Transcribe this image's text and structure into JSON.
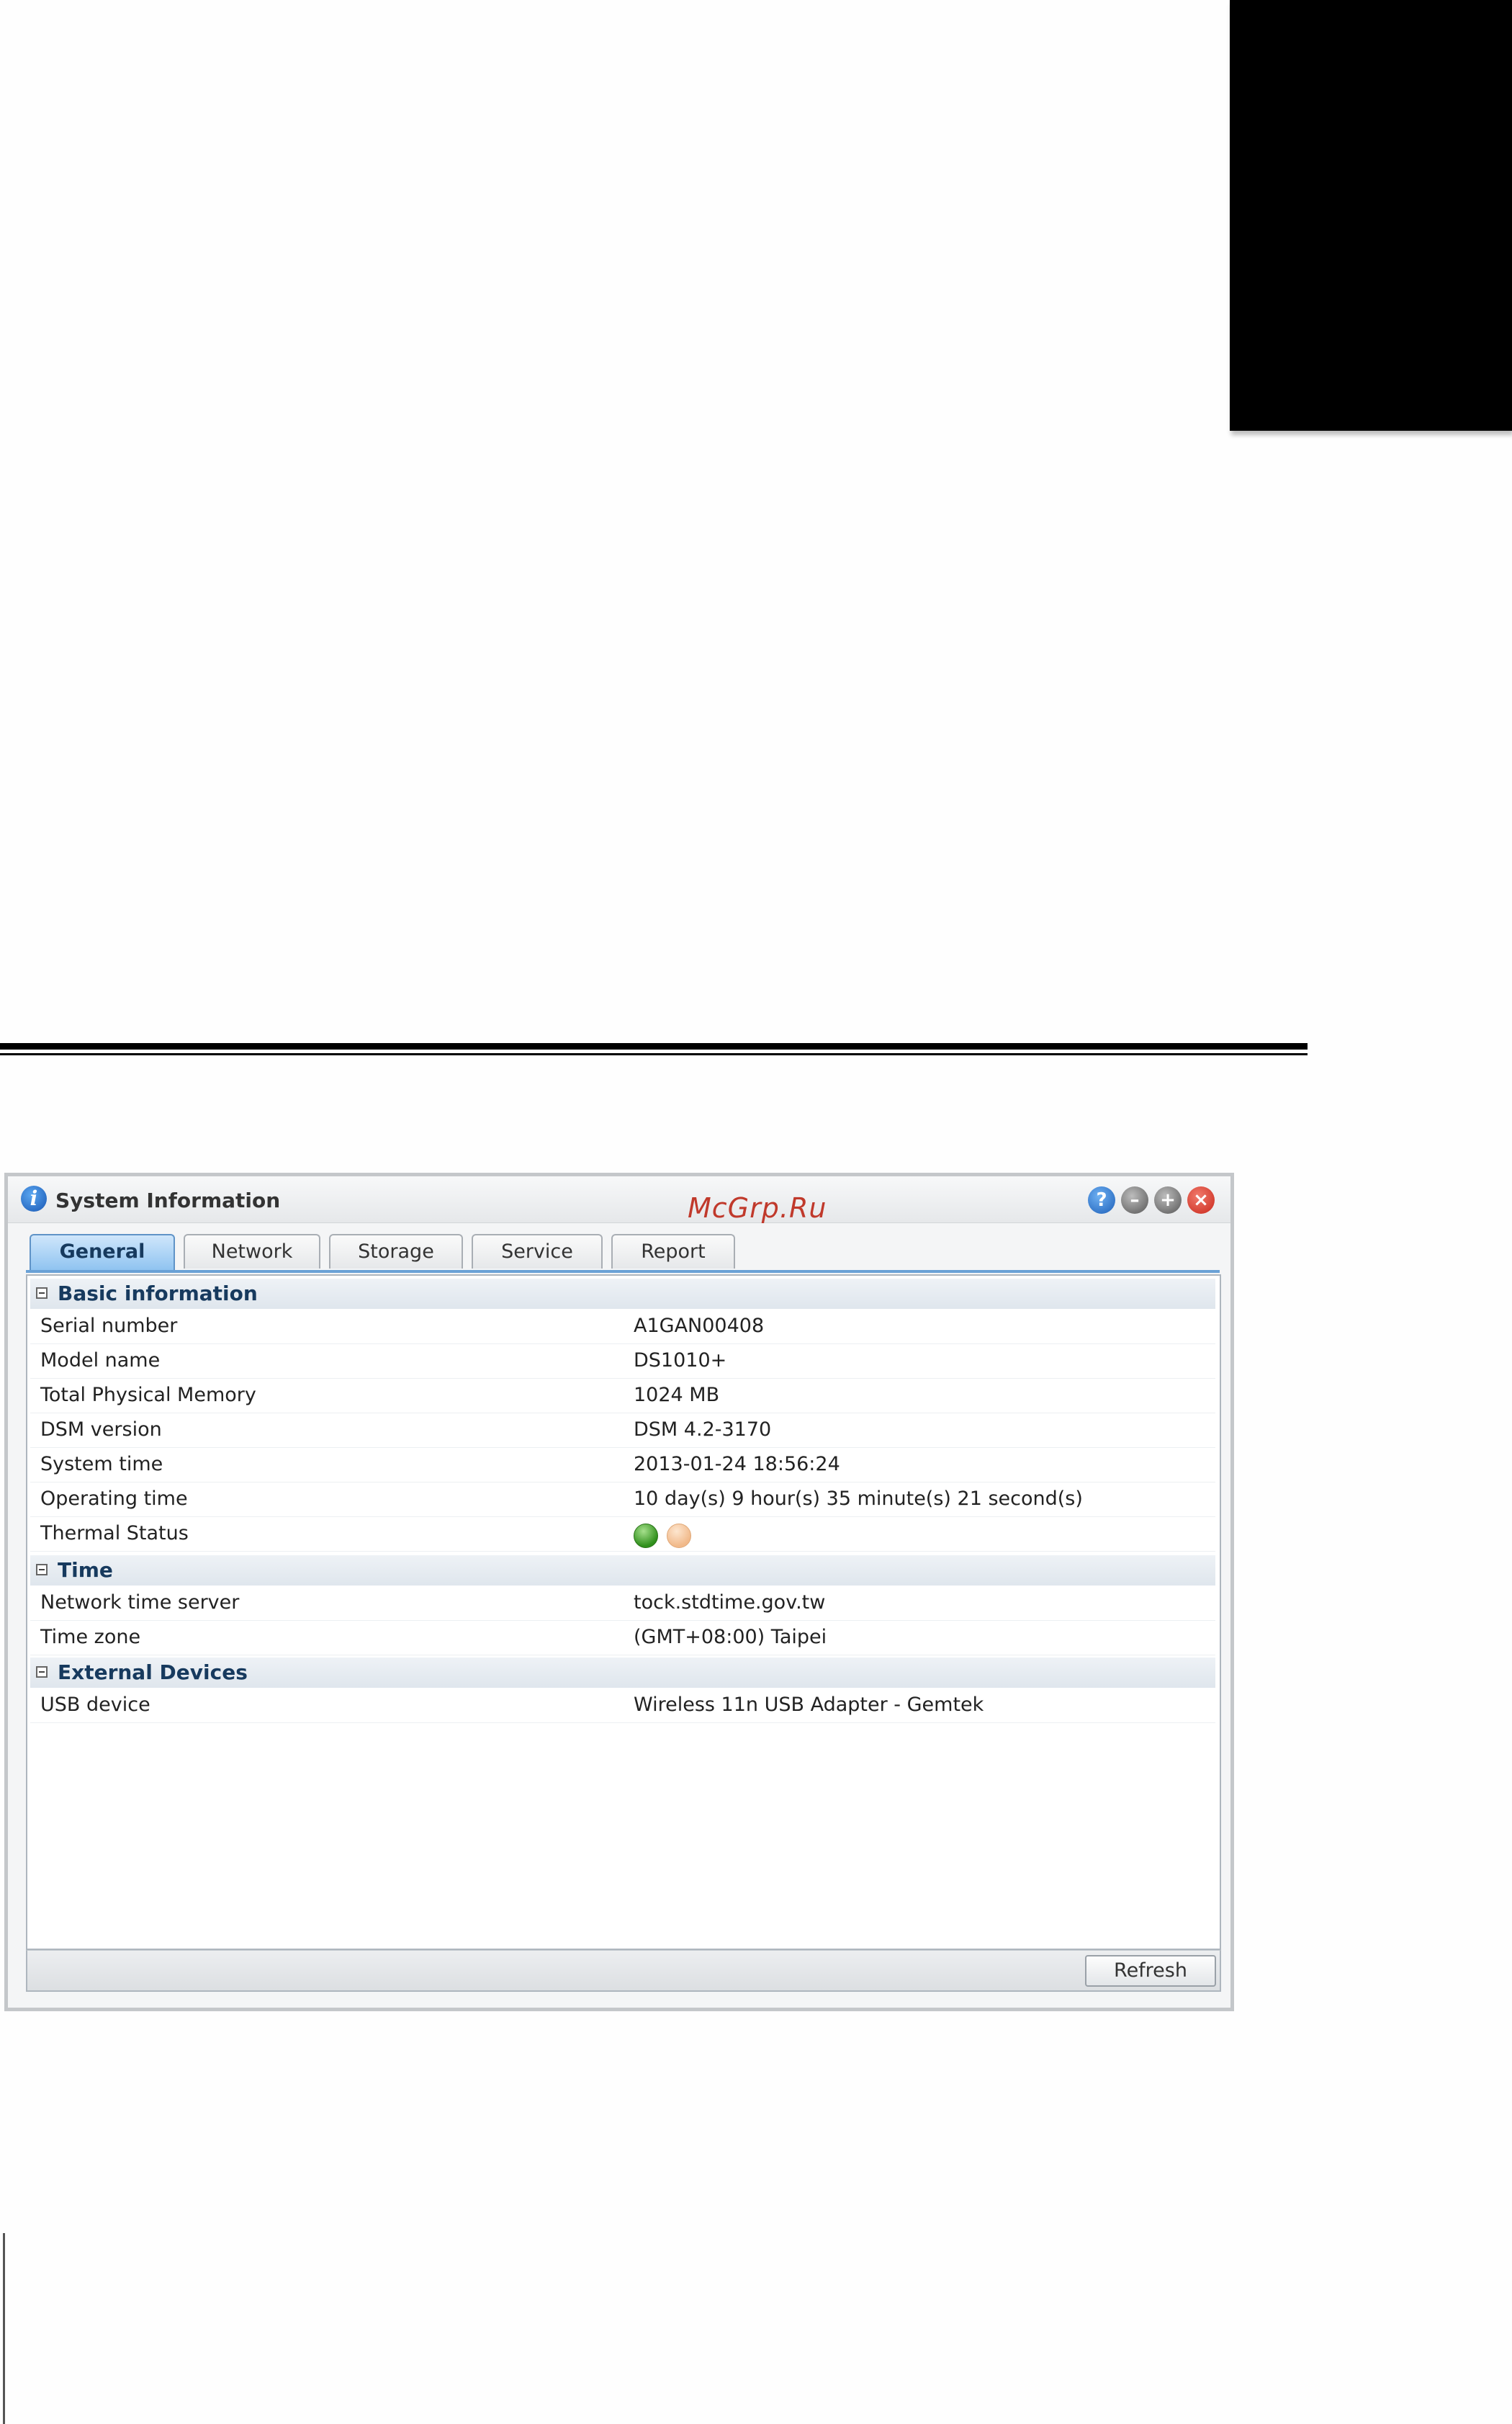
{
  "watermark": "McGrp.Ru",
  "window": {
    "title": "System Information",
    "controls": [
      "help-icon",
      "minimize-icon",
      "maximize-icon",
      "close-icon"
    ]
  },
  "tabs": [
    {
      "label": "General",
      "active": true
    },
    {
      "label": "Network",
      "active": false
    },
    {
      "label": "Storage",
      "active": false
    },
    {
      "label": "Service",
      "active": false
    },
    {
      "label": "Report",
      "active": false
    }
  ],
  "sections": {
    "basic": {
      "title": "Basic information",
      "rows": [
        {
          "label": "Serial number",
          "value": "A1GAN00408"
        },
        {
          "label": "Model name",
          "value": "DS1010+"
        },
        {
          "label": "Total Physical Memory",
          "value": "1024 MB"
        },
        {
          "label": "DSM version",
          "value": "DSM 4.2-3170"
        },
        {
          "label": "System time",
          "value": "2013-01-24 18:56:24"
        },
        {
          "label": "Operating time",
          "value": "10 day(s) 9 hour(s) 35 minute(s) 21 second(s)"
        },
        {
          "label": "Thermal Status",
          "value": "",
          "indicators": [
            "#2f8f1b",
            "#f1b98a"
          ]
        }
      ]
    },
    "time": {
      "title": "Time",
      "rows": [
        {
          "label": "Network time server",
          "value": "tock.stdtime.gov.tw"
        },
        {
          "label": "Time zone",
          "value": "(GMT+08:00) Taipei"
        }
      ]
    },
    "external": {
      "title": "External Devices",
      "rows": [
        {
          "label": "USB device",
          "value": "Wireless 11n USB Adapter - Gemtek"
        }
      ]
    }
  },
  "footer": {
    "refresh_label": "Refresh"
  }
}
